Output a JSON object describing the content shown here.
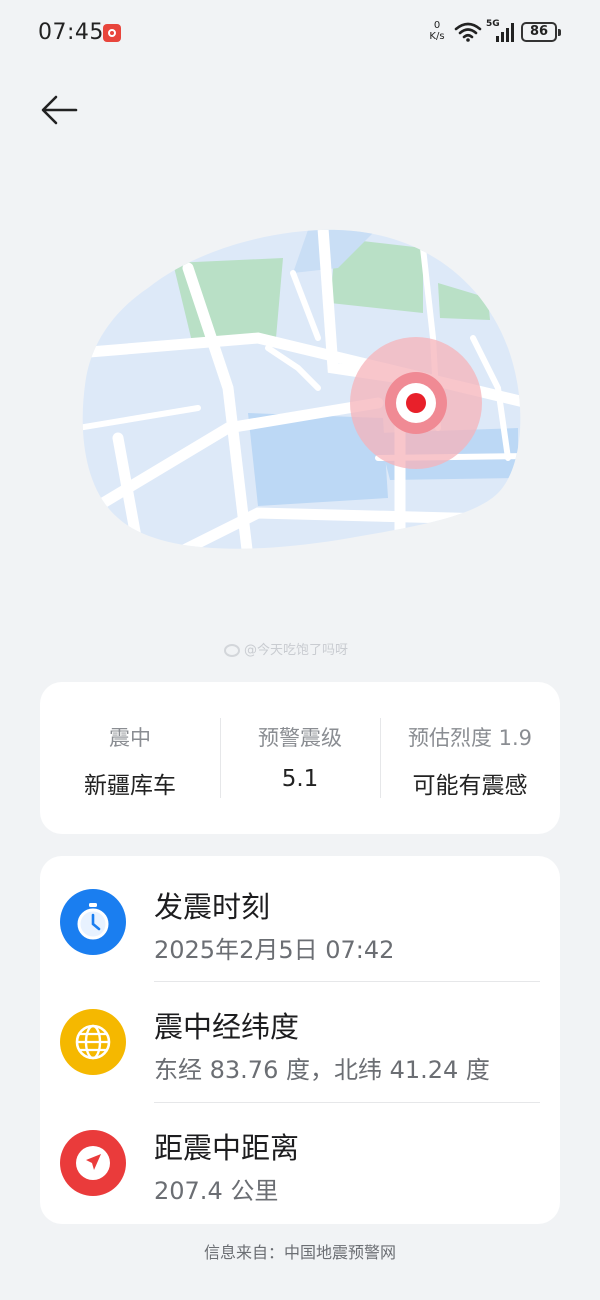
{
  "status_bar": {
    "time": "07:45",
    "net_speed_value": "0",
    "net_speed_unit": "K/s",
    "network": "5G",
    "battery": "86"
  },
  "summary": {
    "epicenter_label": "震中",
    "epicenter_value": "新疆库车",
    "magnitude_label": "预警震级",
    "magnitude_value": "5.1",
    "intensity_label": "预估烈度 1.9",
    "intensity_value": "可能有震感"
  },
  "details": {
    "time_title": "发震时刻",
    "time_value": "2025年2月5日 07:42",
    "coords_title": "震中经纬度",
    "coords_value": "东经 83.76 度，北纬 41.24 度",
    "distance_title": "距震中距离",
    "distance_value": "207.4 公里"
  },
  "watermark": "@今天吃饱了吗呀",
  "source_note": "信息来自：中国地震预警网",
  "icons": {
    "back": "arrow-left-icon",
    "time": "clock-icon",
    "coords": "globe-icon",
    "distance": "navigation-arrow-icon",
    "epicenter": "epicenter-marker"
  },
  "colors": {
    "time_icon_bg": "#1a7ef0",
    "coords_icon_bg": "#f5b800",
    "distance_icon_bg": "#ea3b3b",
    "epicenter": "#e8202a",
    "map_land": "#dde9f8",
    "map_park": "#b9e0c6",
    "map_water": "#bcd8f5"
  }
}
